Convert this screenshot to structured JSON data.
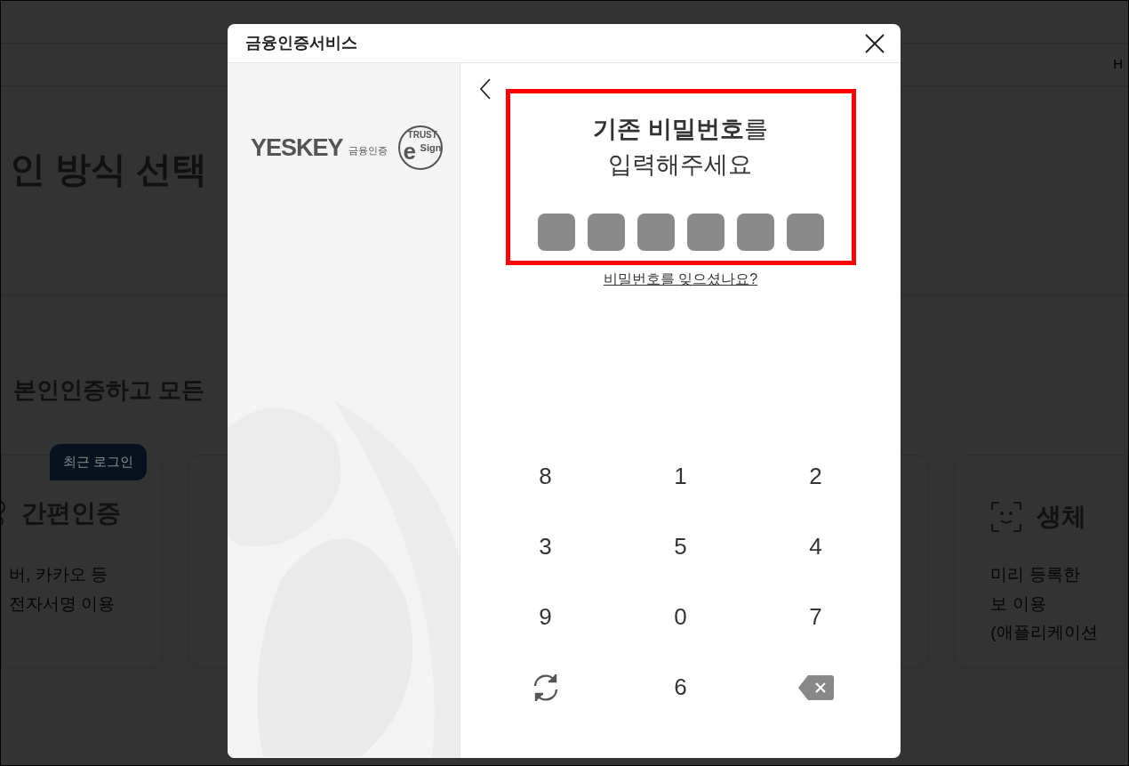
{
  "background_page": {
    "nav_text": "H",
    "heading": "인 방식 선택",
    "subheading": "본인인증하고 모든",
    "badge": "최근 로그인",
    "cards": [
      {
        "title": "간편인증",
        "lines": [
          "버, 카카오 등",
          "전자서명 이용"
        ]
      },
      {
        "title": "생체",
        "lines": [
          "미리 등록한",
          "보 이용",
          "(애플리케이션"
        ]
      }
    ]
  },
  "dialog": {
    "title": "금융인증서비스",
    "logo": {
      "brand": "YESKEY",
      "brand_sub": "금융인증",
      "seal_top": "TRUST",
      "seal_letter": "e",
      "seal_side": "Sign"
    },
    "prompt": [
      "**기존 비밀번호**를",
      "입력해주세요"
    ],
    "highlight": true,
    "pin_slots": [
      {
        "filled": false
      },
      {
        "filled": false
      },
      {
        "filled": false
      },
      {
        "filled": false
      },
      {
        "filled": false
      },
      {
        "filled": false
      }
    ],
    "forgot_link": "비밀번호를 잊으셨나요?",
    "keys": [
      {
        "kind": "digit",
        "label": "8"
      },
      {
        "kind": "digit",
        "label": "1"
      },
      {
        "kind": "digit",
        "label": "2"
      },
      {
        "kind": "digit",
        "label": "3"
      },
      {
        "kind": "digit",
        "label": "5"
      },
      {
        "kind": "digit",
        "label": "4"
      },
      {
        "kind": "digit",
        "label": "9"
      },
      {
        "kind": "digit",
        "label": "0"
      },
      {
        "kind": "digit",
        "label": "7"
      },
      {
        "kind": "refresh"
      },
      {
        "kind": "digit",
        "label": "6"
      },
      {
        "kind": "backspace"
      }
    ]
  }
}
